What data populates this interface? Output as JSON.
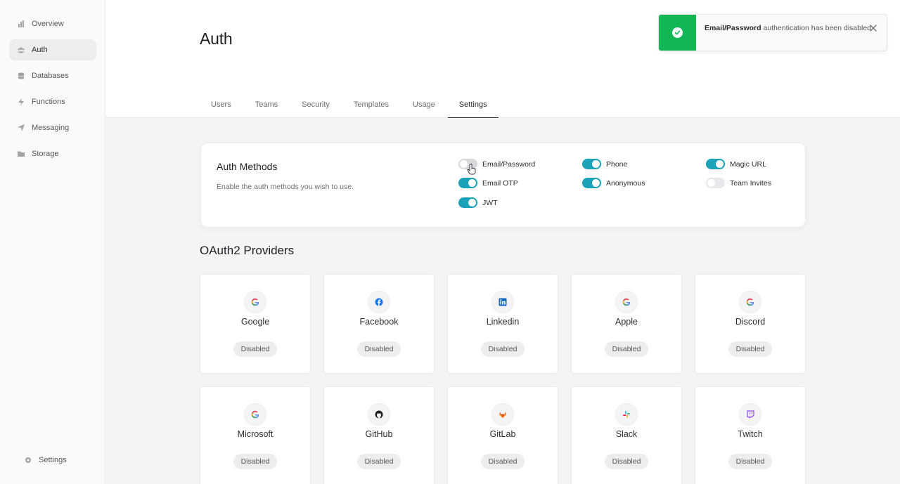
{
  "sidebar": {
    "items": [
      {
        "label": "Overview",
        "icon": "bar-chart-icon",
        "active": false
      },
      {
        "label": "Auth",
        "icon": "users-icon",
        "active": true
      },
      {
        "label": "Databases",
        "icon": "database-icon",
        "active": false
      },
      {
        "label": "Functions",
        "icon": "lightning-icon",
        "active": false
      },
      {
        "label": "Messaging",
        "icon": "send-icon",
        "active": false
      },
      {
        "label": "Storage",
        "icon": "folder-icon",
        "active": false
      }
    ],
    "settings_label": "Settings"
  },
  "header": {
    "title": "Auth",
    "tabs": [
      "Users",
      "Teams",
      "Security",
      "Templates",
      "Usage",
      "Settings"
    ],
    "active_tab": "Settings"
  },
  "toast": {
    "bold": "Email/Password",
    "message": " authentication has been disabled",
    "status_color": "#10b754"
  },
  "auth_methods": {
    "title": "Auth Methods",
    "description": "Enable the auth methods you wish to use.",
    "methods": [
      {
        "label": "Email/Password",
        "enabled": false
      },
      {
        "label": "Phone",
        "enabled": true
      },
      {
        "label": "Magic URL",
        "enabled": true
      },
      {
        "label": "Email OTP",
        "enabled": true
      },
      {
        "label": "Anonymous",
        "enabled": true
      },
      {
        "label": "Team Invites",
        "enabled": false
      },
      {
        "label": "JWT",
        "enabled": true
      }
    ]
  },
  "providers": {
    "title": "OAuth2 Providers",
    "items": [
      {
        "name": "Google",
        "status": "Disabled",
        "icon": "google-icon"
      },
      {
        "name": "Facebook",
        "status": "Disabled",
        "icon": "facebook-icon"
      },
      {
        "name": "Linkedin",
        "status": "Disabled",
        "icon": "linkedin-icon"
      },
      {
        "name": "Apple",
        "status": "Disabled",
        "icon": "google-icon"
      },
      {
        "name": "Discord",
        "status": "Disabled",
        "icon": "google-icon"
      },
      {
        "name": "Microsoft",
        "status": "Disabled",
        "icon": "google-icon"
      },
      {
        "name": "GitHub",
        "status": "Disabled",
        "icon": "github-icon"
      },
      {
        "name": "GitLab",
        "status": "Disabled",
        "icon": "gitlab-icon"
      },
      {
        "name": "Slack",
        "status": "Disabled",
        "icon": "slack-icon"
      },
      {
        "name": "Twitch",
        "status": "Disabled",
        "icon": "twitch-icon"
      }
    ]
  },
  "colors": {
    "accent": "#19a2b8",
    "success": "#10b754"
  }
}
